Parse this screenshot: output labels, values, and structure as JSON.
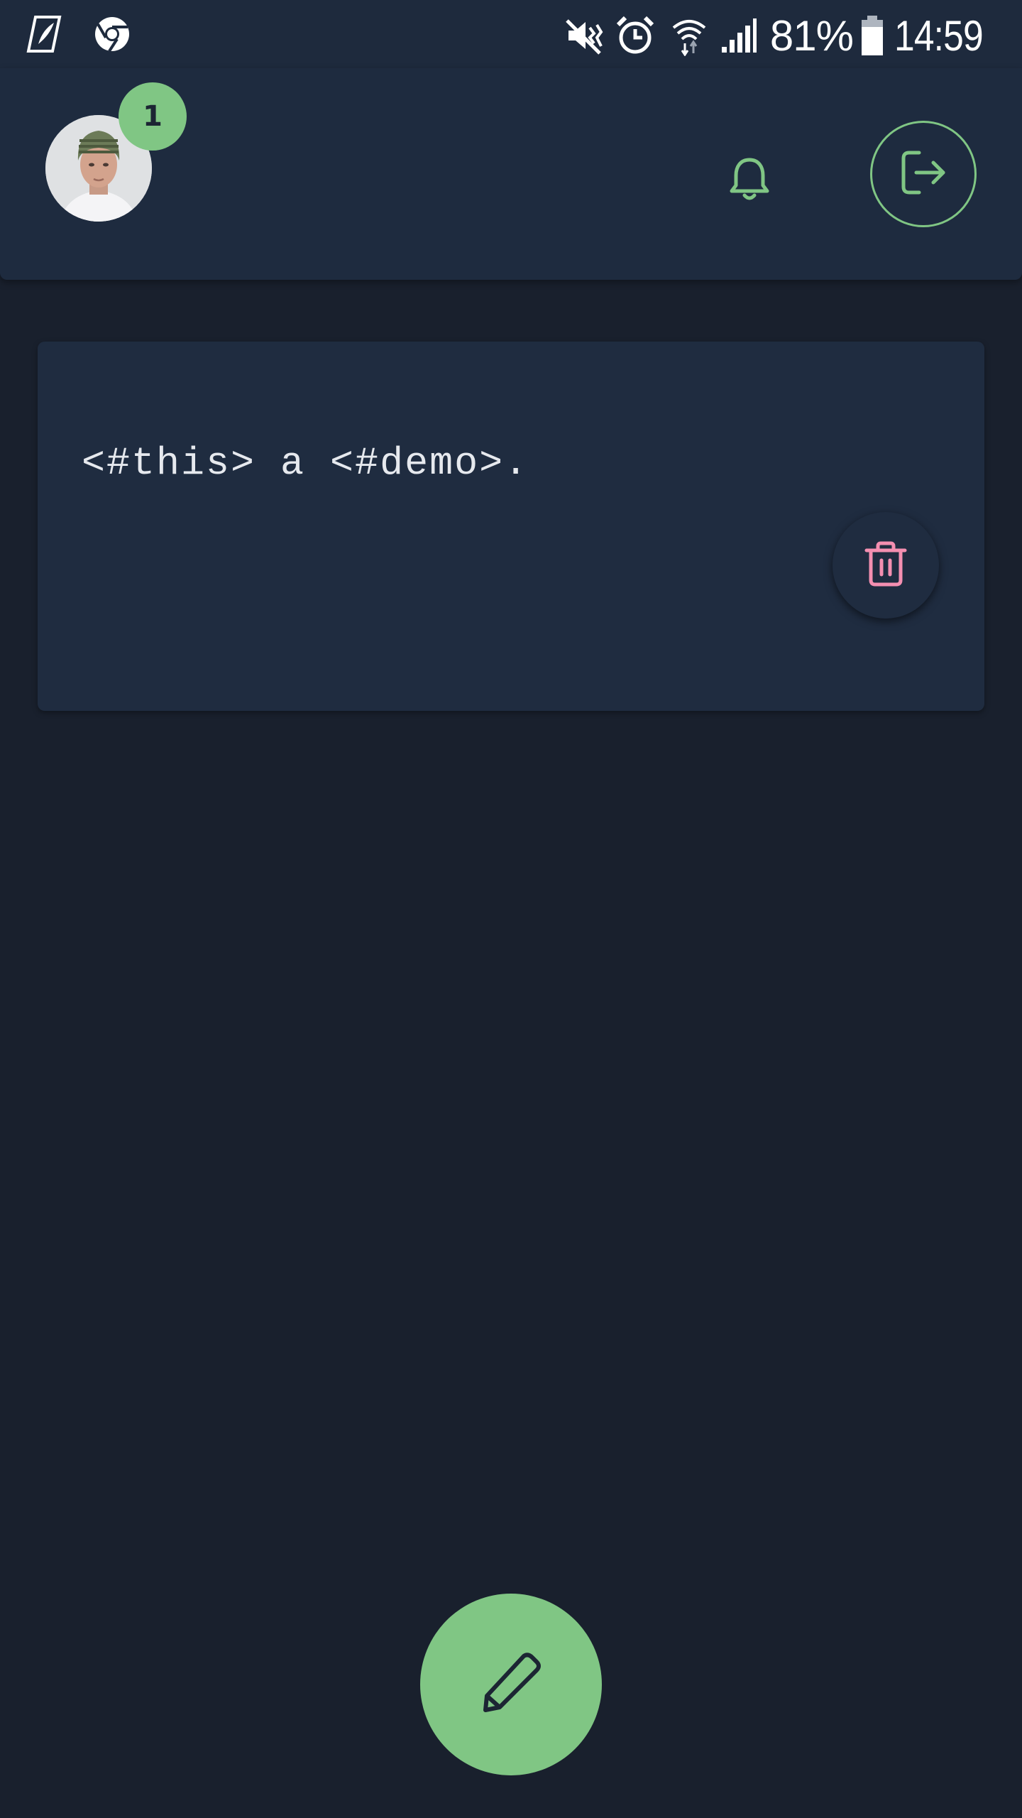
{
  "status_bar": {
    "battery_percent": "81%",
    "time": "14:59",
    "icons": [
      "feather-app-icon",
      "chrome-icon",
      "mute-icon",
      "alarm-icon",
      "wifi-icon",
      "signal-icon",
      "battery-icon"
    ]
  },
  "header": {
    "notification_count": "1",
    "icons": [
      "avatar",
      "bell-icon",
      "logout-icon"
    ]
  },
  "feed": {
    "posts": [
      {
        "text": "<#this> a <#demo>."
      }
    ]
  },
  "colors": {
    "accent": "#80c684",
    "danger": "#f48fb1",
    "background": "#19202d",
    "surface": "#1f2c40"
  },
  "fab": {
    "icon": "pencil-icon"
  }
}
